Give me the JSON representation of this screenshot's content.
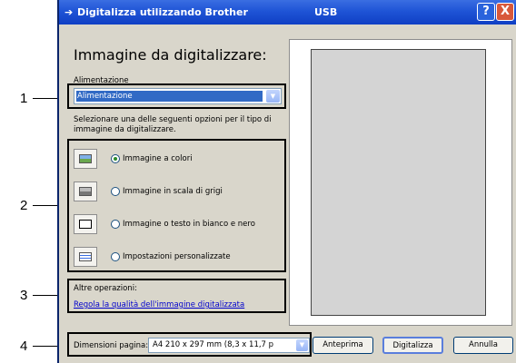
{
  "window": {
    "title": "Digitalizza utilizzando Brother",
    "device": "USB"
  },
  "titlebar": {
    "help_label": "?",
    "close_label": "X"
  },
  "heading": "Immagine da digitalizzare:",
  "source": {
    "label": "Alimentazione",
    "selected": "Alimentazione"
  },
  "instructions": {
    "line1": "Selezionare una delle seguenti opzioni per il tipo di",
    "line2": "immagine da digitalizzare."
  },
  "options": [
    {
      "label": "Immagine a colori",
      "selected": true
    },
    {
      "label": "Immagine in scala di grigi",
      "selected": false
    },
    {
      "label": "Immagine o testo in bianco e nero",
      "selected": false
    },
    {
      "label": "Impostazioni personalizzate",
      "selected": false
    }
  ],
  "other": {
    "label": "Altre operazioni:",
    "link": "Regola la qualità dell'immagine digitalizzata"
  },
  "page_size": {
    "label": "Dimensioni pagina:",
    "value": "A4 210 x 297 mm (8,3 x 11,7 p"
  },
  "buttons": {
    "preview": "Anteprima",
    "scan": "Digitalizza",
    "cancel": "Annulla"
  },
  "callouts": [
    "1",
    "2",
    "3",
    "4"
  ]
}
